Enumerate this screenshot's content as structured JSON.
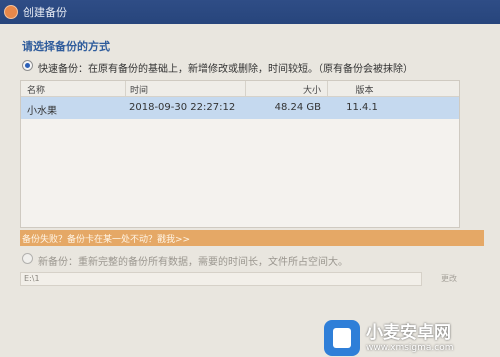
{
  "window": {
    "title": "创建备份"
  },
  "section": {
    "title": "请选择备份的方式"
  },
  "quick_backup": {
    "label": "快速备份：在原有备份的基础上，新增修改或删除，时间较短。（原有备份会被抹除）"
  },
  "table": {
    "headers": {
      "name": "名称",
      "time": "时间",
      "size": "大小",
      "version": "版本"
    },
    "rows": [
      {
        "name": "小水果",
        "time": "2018-09-30 22:27:12",
        "size": "48.24 GB",
        "version": "11.4.1"
      }
    ]
  },
  "help": {
    "text": "备份失败？备份卡在某一处不动？戳我>>"
  },
  "new_backup": {
    "label": "新备份：重新完整的备份所有数据，需要的时间长，文件所占空间大。"
  },
  "path": {
    "value": "E:\\1"
  },
  "change_button": {
    "label": "更改"
  },
  "watermark": {
    "title": "小麦安卓网",
    "url": "www.xmsigma.com"
  },
  "colors": {
    "titlebar": "#2f4d86",
    "section_title": "#2f5c9c",
    "selected_row": "#c5d9ef",
    "help_bar": "#e5a866"
  },
  "icons": {
    "title": "app-icon",
    "logo": "phone-icon"
  }
}
